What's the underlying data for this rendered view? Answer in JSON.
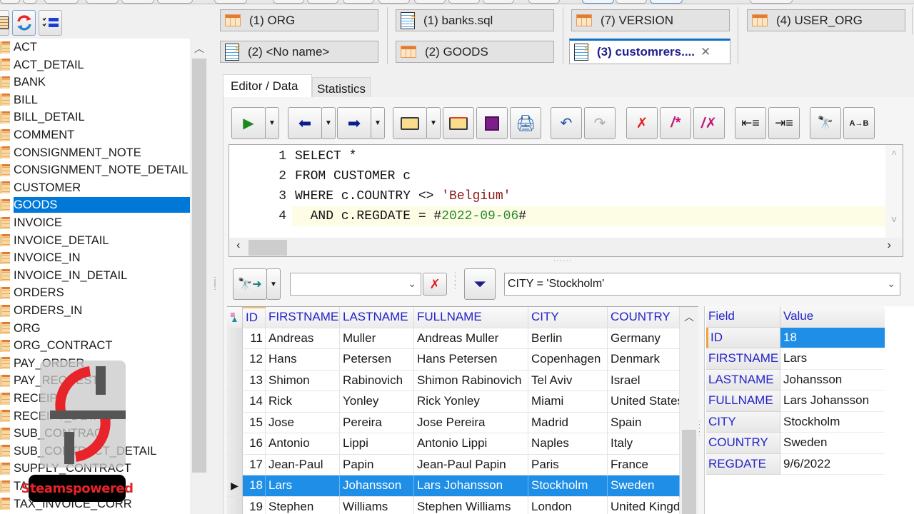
{
  "left_toolbar": {
    "buttons": [
      {
        "name": "clipboard-icon"
      },
      {
        "name": "refresh-icon"
      },
      {
        "name": "checklist-icon"
      }
    ]
  },
  "tables": {
    "items": [
      "ACT",
      "ACT_DETAIL",
      "BANK",
      "BILL",
      "BILL_DETAIL",
      "COMMENT",
      "CONSIGNMENT_NOTE",
      "CONSIGNMENT_NOTE_DETAIL",
      "CUSTOMER",
      "GOODS",
      "INVOICE",
      "INVOICE_DETAIL",
      "INVOICE_IN",
      "INVOICE_IN_DETAIL",
      "ORDERS",
      "ORDERS_IN",
      "ORG",
      "ORG_CONTRACT",
      "PAY_ORDER",
      "PAY_REQUEST",
      "RECEIPT",
      "RECEIPT_DETAIL",
      "SUB_CONTRACT",
      "SUB_CONTRACT_DETAIL",
      "SUPPLY_CONTRACT",
      "TAX_INVOICE",
      "TAX_INVOICE_CORR"
    ],
    "selected": "GOODS"
  },
  "doc_tabs": [
    {
      "label": "(1) ORG",
      "type": "table"
    },
    {
      "label": "(1) banks.sql",
      "type": "sql"
    },
    {
      "label": "(7) VERSION",
      "type": "table"
    },
    {
      "label": "(4) USER_ORG",
      "type": "table"
    },
    {
      "label": "(2) <No name>",
      "type": "sql"
    },
    {
      "label": "(2) GOODS",
      "type": "table"
    },
    {
      "label": "(3) customrers....",
      "type": "sql",
      "active": true
    }
  ],
  "sub_tabs": {
    "editor": "Editor / Data",
    "statistics": "Statistics"
  },
  "sql": {
    "lines": [
      {
        "num": "1",
        "parts": [
          {
            "t": "SELECT *",
            "c": "kw"
          }
        ]
      },
      {
        "num": "2",
        "parts": [
          {
            "t": "FROM CUSTOMER c",
            "c": "kw"
          }
        ]
      },
      {
        "num": "3",
        "parts": [
          {
            "t": "WHERE c.COUNTRY <> ",
            "c": "kw"
          },
          {
            "t": "'Belgium'",
            "c": "str"
          }
        ]
      },
      {
        "num": "4",
        "parts": [
          {
            "t": "  AND c.REGDATE = #",
            "c": "kw"
          },
          {
            "t": "2022-09-06",
            "c": "date"
          },
          {
            "t": "#",
            "c": "kw"
          }
        ]
      }
    ],
    "current_line": 4
  },
  "filter": {
    "search_value": "",
    "filter_value": "CITY = 'Stockholm'"
  },
  "grid": {
    "columns": [
      "ID",
      "FIRSTNAME",
      "LASTNAME",
      "FULLNAME",
      "CITY",
      "COUNTRY"
    ],
    "rows": [
      [
        "11",
        "Andreas",
        "Muller",
        "Andreas Muller",
        "Berlin",
        "Germany"
      ],
      [
        "12",
        "Hans",
        "Petersen",
        "Hans Petersen",
        "Copenhagen",
        "Denmark"
      ],
      [
        "13",
        "Shimon",
        "Rabinovich",
        "Shimon Rabinovich",
        "Tel Aviv",
        "Israel"
      ],
      [
        "14",
        "Rick",
        "Yonley",
        "Rick Yonley",
        "Miami",
        "United States"
      ],
      [
        "15",
        "Jose",
        "Pereira",
        "Jose Pereira",
        "Madrid",
        "Spain"
      ],
      [
        "16",
        "Antonio",
        "Lippi",
        "Antonio Lippi",
        "Naples",
        "Italy"
      ],
      [
        "17",
        "Jean-Paul",
        "Papin",
        "Jean-Paul Papin",
        "Paris",
        "France"
      ],
      [
        "18",
        "Lars",
        "Johansson",
        "Lars Johansson",
        "Stockholm",
        "Sweden"
      ],
      [
        "19",
        "Stephen",
        "Williams",
        "Stephen Williams",
        "London",
        "United Kingdom"
      ]
    ],
    "selected_id": "18"
  },
  "record": {
    "header": [
      "Field",
      "Value"
    ],
    "fields": [
      {
        "field": "ID",
        "value": "18"
      },
      {
        "field": "FIRSTNAME",
        "value": "Lars"
      },
      {
        "field": "LASTNAME",
        "value": "Johansson"
      },
      {
        "field": "FULLNAME",
        "value": "Lars Johansson"
      },
      {
        "field": "CITY",
        "value": "Stockholm"
      },
      {
        "field": "COUNTRY",
        "value": "Sweden"
      },
      {
        "field": "REGDATE",
        "value": "9/6/2022"
      }
    ]
  },
  "watermark": {
    "label": "Steamspowered"
  },
  "colors": {
    "selection": "#0078d7",
    "grid_selection": "#1e8ee6",
    "header_text": "#2323c8",
    "active_tab_border": "#0e6fc9"
  }
}
